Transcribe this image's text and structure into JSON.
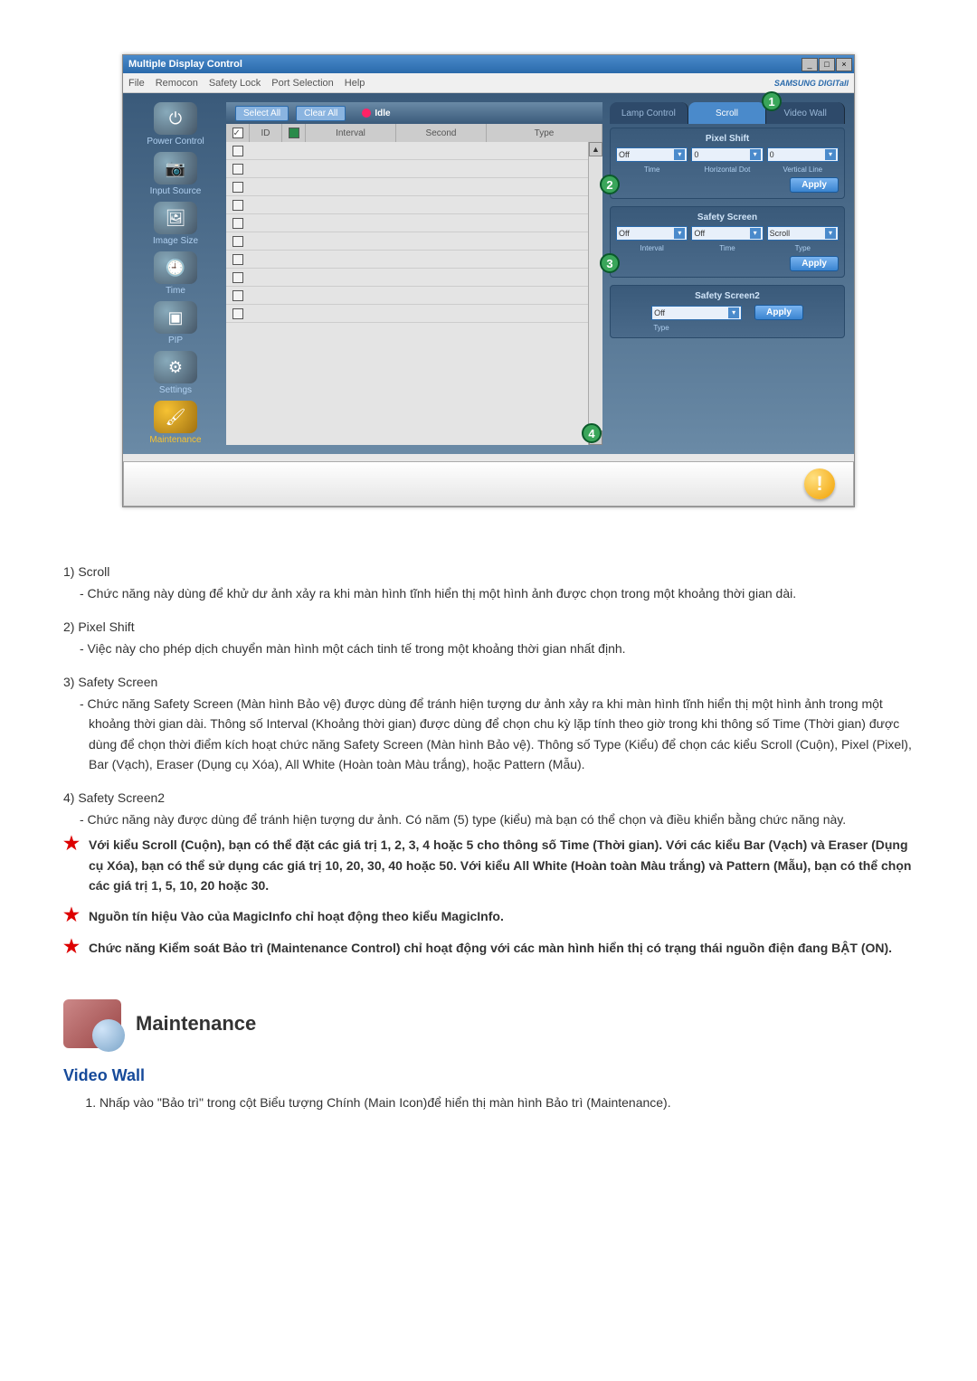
{
  "window": {
    "title": "Multiple Display Control",
    "menu": [
      "File",
      "Remocon",
      "Safety Lock",
      "Port Selection",
      "Help"
    ],
    "brand": "SAMSUNG DIGITall"
  },
  "toolbar": {
    "select_all": "Select All",
    "clear_all": "Clear All",
    "idle": "Idle"
  },
  "sidebar": {
    "items": [
      {
        "label": "Power Control",
        "glyph": "⏻"
      },
      {
        "label": "Input Source",
        "glyph": "📷"
      },
      {
        "label": "Image Size",
        "glyph": "🖼"
      },
      {
        "label": "Time",
        "glyph": "🕘"
      },
      {
        "label": "PIP",
        "glyph": "▣"
      },
      {
        "label": "Settings",
        "glyph": "⚙"
      },
      {
        "label": "Maintenance",
        "glyph": "🖌"
      }
    ]
  },
  "grid": {
    "headers": {
      "chk": "",
      "id": "ID",
      "m": "",
      "interval": "Interval",
      "second": "Second",
      "type": "Type"
    }
  },
  "tabs": {
    "lamp": "Lamp Control",
    "scroll": "Scroll",
    "videowall": "Video Wall"
  },
  "pixel_shift": {
    "title": "Pixel Shift",
    "time_val": "Off",
    "h_val": "0",
    "v_val": "0",
    "time_lbl": "Time",
    "h_lbl": "Horizontal Dot",
    "v_lbl": "Vertical Line",
    "apply": "Apply"
  },
  "safety_screen": {
    "title": "Safety Screen",
    "interval_val": "Off",
    "time_val": "Off",
    "type_val": "Scroll",
    "interval_lbl": "Interval",
    "time_lbl": "Time",
    "type_lbl": "Type",
    "apply": "Apply"
  },
  "safety_screen2": {
    "title": "Safety Screen2",
    "type_val": "Off",
    "type_lbl": "Type",
    "apply": "Apply"
  },
  "callouts": {
    "c1": "1",
    "c2": "2",
    "c3": "3",
    "c4": "4"
  },
  "doc": {
    "i1_h": "1)  Scroll",
    "i1_b": "- Chức năng này dùng để khử dư ảnh xảy ra khi màn hình tĩnh hiển thị một hình ảnh được chọn trong một khoảng thời gian dài.",
    "i2_h": "2)  Pixel Shift",
    "i2_b": "- Việc này cho phép dịch chuyển màn hình một cách tinh tế trong một khoảng thời gian nhất định.",
    "i3_h": "3)  Safety Screen",
    "i3_b": "- Chức năng Safety Screen (Màn hình Bảo vệ) được dùng để tránh hiện tượng dư ảnh xảy ra khi màn hình tĩnh hiển thị một hình ảnh trong một khoảng thời gian dài.  Thông số Interval (Khoảng thời gian) được dùng để chọn chu kỳ lặp tính theo giờ trong khi thông số Time (Thời gian) được dùng để chọn thời điểm kích hoạt chức năng Safety Screen (Màn hình Bảo vệ). Thông số Type (Kiểu) để chọn các kiểu Scroll (Cuộn), Pixel (Pixel), Bar (Vạch), Eraser (Dụng cụ Xóa), All White (Hoàn toàn Màu trắng), hoặc Pattern (Mẫu).",
    "i4_h": "4)  Safety Screen2",
    "i4_b": "- Chức năng này được dùng để tránh hiện tượng dư ảnh. Có năm (5) type (kiểu) mà bạn có thể chọn và điều khiển bằng chức năng này.",
    "n1": "Với kiểu Scroll (Cuộn), bạn có thể đặt các giá trị 1, 2, 3, 4 hoặc 5 cho thông số Time (Thời gian). Với các kiểu Bar (Vạch) và Eraser (Dụng cụ Xóa), bạn có thể sử dụng các giá trị 10, 20, 30, 40 hoặc 50. Với kiểu All White (Hoàn toàn Màu trắng) và Pattern (Mẫu), bạn có thể chọn các giá trị 1, 5, 10, 20 hoặc 30.",
    "n2": "Nguồn tín hiệu Vào của MagicInfo chỉ hoạt động theo kiểu MagicInfo.",
    "n3": "Chức năng Kiểm soát Bảo trì (Maintenance Control) chỉ hoạt động với các màn hình hiển thị có trạng thái nguồn điện đang BẬT (ON).",
    "section_title": "Maintenance",
    "sub_title": "Video Wall",
    "step1": "Nhấp vào \"Bảo trì\" trong cột Biểu tượng Chính (Main Icon)để hiển thị màn hình Bảo trì (Maintenance)."
  }
}
